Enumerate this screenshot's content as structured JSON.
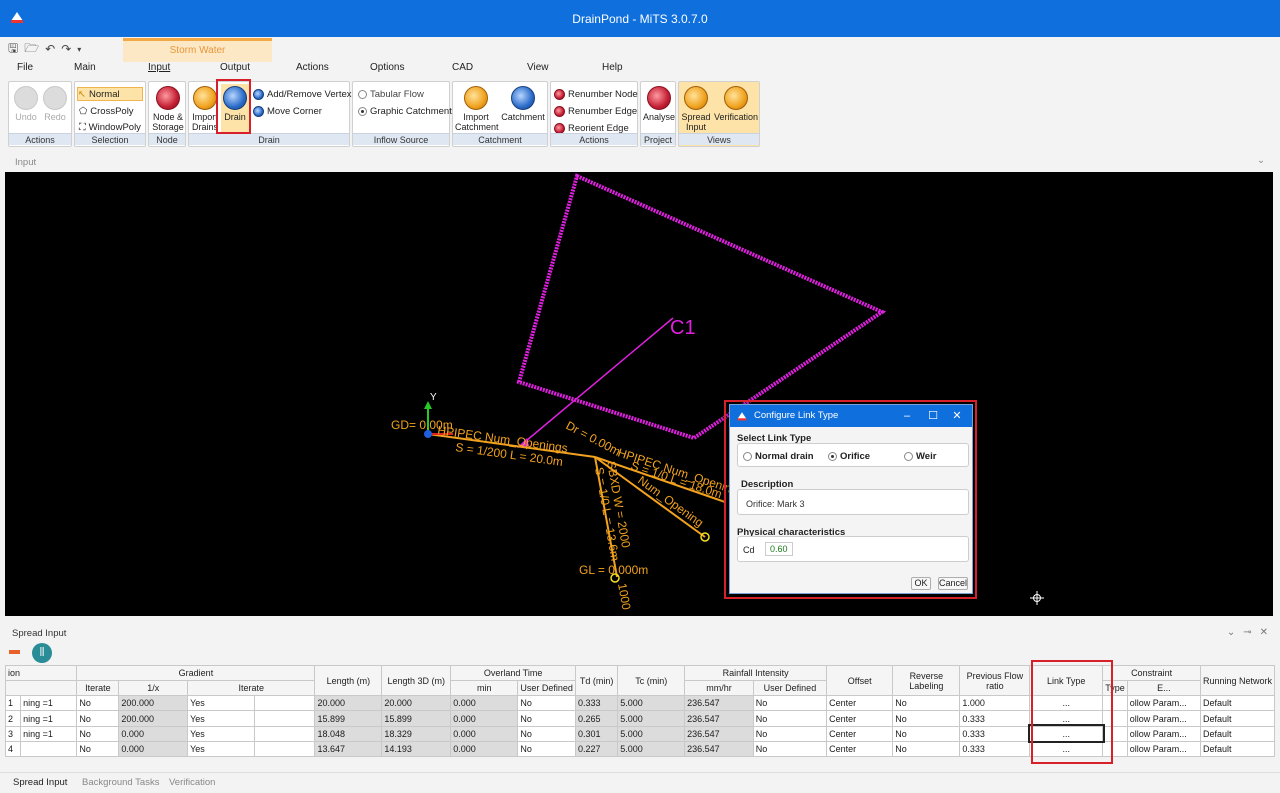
{
  "window": {
    "title": "DrainPond - MiTS 3.0.7.0"
  },
  "qat": [
    "save-icon",
    "open-icon",
    "undo-icon",
    "redo-icon",
    "customize-icon"
  ],
  "context_group": "Storm Water",
  "tabs": [
    "File",
    "Main",
    "Input",
    "Output",
    "Actions",
    "Options",
    "CAD",
    "View",
    "Help"
  ],
  "selected_tab": "Input",
  "ribbon": {
    "actions": {
      "label": "Actions",
      "undo": "Undo",
      "redo": "Redo"
    },
    "selection": {
      "label": "Selection",
      "normal": "Normal",
      "crosspoly": "CrossPoly",
      "windowpoly": "WindowPoly"
    },
    "node": {
      "label": "Node",
      "node_storage": [
        "Node &",
        "Storage"
      ]
    },
    "drain": {
      "label": "Drain",
      "import_drains": [
        "Import",
        "Drains"
      ],
      "drain": "Drain",
      "add_remove_vertex": "Add/Remove Vertex",
      "move_corner": "Move Corner"
    },
    "inflow": {
      "label": "Inflow Source",
      "tabular": "Tabular Flow",
      "graphic": "Graphic Catchment"
    },
    "catchment": {
      "label": "Catchment",
      "import": [
        "Import",
        "Catchment"
      ],
      "catchment": "Catchment"
    },
    "actions2": {
      "label": "Actions",
      "renumber_node": "Renumber Node",
      "renumber_edge": "Renumber Edge",
      "reorient_edge": "Reorient Edge"
    },
    "project": {
      "label": "Project",
      "analyse": "Analyse"
    },
    "views": {
      "label": "Views",
      "spread_input": [
        "Spread",
        "Input"
      ],
      "verification": "Verification"
    }
  },
  "pane_header": "Input",
  "canvas": {
    "catchment_label": "C1",
    "axis_y": "Y",
    "texts": {
      "gd": "GD= 0.00m",
      "pipe1": "HPIPEC  Num_Openings",
      "s1": "S = 1/200  L = 20.0m",
      "dr": "Dr = 0.00m",
      "pipe2": "HPIPEC  Num_Opening",
      "s2": "S = 1/0  L = 18.0m",
      "pipe3": "SBXD  W = 2000",
      "s3": "S = 1/0  L = 13.6m",
      "num3": "Num_Opening",
      "gl": "GL = 0.000m",
      "v1000": "1000"
    }
  },
  "dialog": {
    "title": "Configure Link Type",
    "select_label": "Select Link Type",
    "options": [
      "Normal drain",
      "Orifice",
      "Weir"
    ],
    "selected": "Orifice",
    "description_label": "Description",
    "description_value": "Orifice: Mark 3",
    "physical_label": "Physical characteristics",
    "cd_label": "Cd",
    "cd_value": "0.60",
    "ok": "OK",
    "cancel": "Cancel"
  },
  "spread": {
    "title": "Spread Input",
    "header1": [
      "ion",
      "Gradient",
      "Length (m)",
      "Length 3D (m)",
      "Overland Time",
      "Td (min)",
      "Tc (min)",
      "Rainfall Intensity",
      "Offset",
      "Reverse Labeling",
      "Previous Flow ratio",
      "Link Type",
      "Constraint",
      "Running Network"
    ],
    "header2": [
      "Iterate",
      "1/x",
      "Iterate",
      "min",
      "User Defined",
      "mm/hr",
      "User Defined",
      "Type",
      "E..."
    ],
    "rows": [
      {
        "id": "1",
        "name": "ning =1",
        "iterate": "No",
        "gx": "200.000",
        "giter": "Yes",
        "len": "20.000",
        "len3d": "20.000",
        "omin": "0.000",
        "oud": "No",
        "td": "0.333",
        "tc": "5.000",
        "ri": "236.547",
        "riud": "No",
        "offset": "Center",
        "rev": "No",
        "prev": "1.000",
        "link": "...",
        "ctype": "ollow Param...",
        "net": "Default"
      },
      {
        "id": "2",
        "name": "ning =1",
        "iterate": "No",
        "gx": "200.000",
        "giter": "Yes",
        "len": "15.899",
        "len3d": "15.899",
        "omin": "0.000",
        "oud": "No",
        "td": "0.265",
        "tc": "5.000",
        "ri": "236.547",
        "riud": "No",
        "offset": "Center",
        "rev": "No",
        "prev": "0.333",
        "link": "...",
        "ctype": "ollow Param...",
        "net": "Default"
      },
      {
        "id": "3",
        "name": "ning =1",
        "iterate": "No",
        "gx": "0.000",
        "giter": "Yes",
        "len": "18.048",
        "len3d": "18.329",
        "omin": "0.000",
        "oud": "No",
        "td": "0.301",
        "tc": "5.000",
        "ri": "236.547",
        "riud": "No",
        "offset": "Center",
        "rev": "No",
        "prev": "0.333",
        "link": "...",
        "ctype": "ollow Param...",
        "net": "Default"
      },
      {
        "id": "4",
        "name": "",
        "iterate": "No",
        "gx": "0.000",
        "giter": "Yes",
        "len": "13.647",
        "len3d": "14.193",
        "omin": "0.000",
        "oud": "No",
        "td": "0.227",
        "tc": "5.000",
        "ri": "236.547",
        "riud": "No",
        "offset": "Center",
        "rev": "No",
        "prev": "0.333",
        "link": "...",
        "ctype": "ollow Param...",
        "net": "Default"
      }
    ]
  },
  "bottom_tabs": [
    "Spread Input",
    "Background Tasks",
    "Verification"
  ],
  "colors": {
    "titlebar": "#0f6fdc",
    "canvas": "#000000",
    "magenta": "#e020e0",
    "orange": "#f2a21e",
    "highlight": "#d8202a"
  }
}
